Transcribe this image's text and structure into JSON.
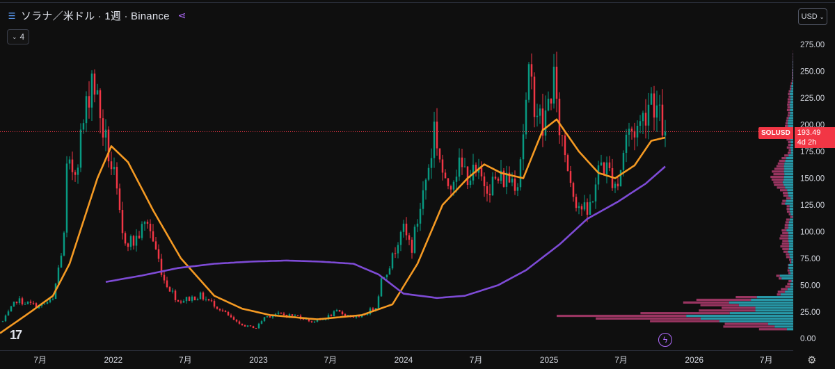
{
  "header": {
    "title": "ソラナ／米ドル · 1週 · Binance",
    "indicator_count": "4"
  },
  "currency_button": "USD",
  "price_badge": {
    "symbol": "SOLUSD",
    "price": "193.49",
    "countdown": "4d 2h"
  },
  "chart_data": {
    "type": "candlestick",
    "last_price": 193.49,
    "y_range": [
      -7,
      292
    ],
    "y_ticks": [
      0,
      25,
      50,
      75,
      100,
      125,
      150,
      175,
      200,
      225,
      250,
      275
    ],
    "y_tick_labels": [
      "0.00",
      "25.00",
      "50.00",
      "75.00",
      "100.00",
      "125.00",
      "150.00",
      "175.00",
      "200.00",
      "225.00",
      "250.00",
      "275.00"
    ],
    "x_range": [
      "2021-03-22",
      "2026-09-07"
    ],
    "x_ticks": [
      {
        "date": "2021-07-01",
        "label": "7月"
      },
      {
        "date": "2022-01-01",
        "label": "2022"
      },
      {
        "date": "2022-07-01",
        "label": "7月"
      },
      {
        "date": "2023-01-01",
        "label": "2023"
      },
      {
        "date": "2023-07-01",
        "label": "7月"
      },
      {
        "date": "2024-01-01",
        "label": "2024"
      },
      {
        "date": "2024-07-01",
        "label": "7月"
      },
      {
        "date": "2025-01-01",
        "label": "2025"
      },
      {
        "date": "2025-07-01",
        "label": "7月"
      },
      {
        "date": "2026-01-01",
        "label": "2026"
      },
      {
        "date": "2026-07-01",
        "label": "7月"
      }
    ],
    "price_path_date_anchors": [
      "2021-03-29",
      "2021-05-03",
      "2021-06-28",
      "2021-08-02",
      "2021-08-30",
      "2021-09-06",
      "2021-09-27",
      "2021-10-25",
      "2021-11-08",
      "2021-12-06",
      "2022-01-03",
      "2022-01-24",
      "2022-02-21",
      "2022-03-28",
      "2022-05-09",
      "2022-06-13",
      "2022-08-08",
      "2022-09-12",
      "2022-11-07",
      "2022-11-14",
      "2022-12-26",
      "2023-01-16",
      "2023-02-13",
      "2023-04-10",
      "2023-05-15",
      "2023-06-12",
      "2023-07-17",
      "2023-08-21",
      "2023-09-11",
      "2023-10-23",
      "2023-11-06",
      "2023-12-04",
      "2023-12-25",
      "2024-01-22",
      "2024-03-11",
      "2024-03-18",
      "2024-04-15",
      "2024-05-13",
      "2024-07-08",
      "2024-08-05",
      "2024-09-09",
      "2024-10-14",
      "2024-11-11",
      "2024-11-18",
      "2024-12-16",
      "2025-01-13",
      "2025-01-20",
      "2025-02-24",
      "2025-03-10",
      "2025-04-07",
      "2025-05-12",
      "2025-06-23",
      "2025-07-14",
      "2025-08-18",
      "2025-09-15",
      "2025-10-06",
      "2025-10-20"
    ],
    "price_path_value_anchors": [
      16,
      36,
      30,
      36,
      95,
      155,
      160,
      215,
      250,
      195,
      150,
      95,
      90,
      110,
      55,
      35,
      40,
      32,
      15,
      13,
      10,
      20,
      23,
      21,
      16,
      18,
      25,
      21,
      19,
      30,
      55,
      75,
      105,
      85,
      175,
      200,
      140,
      160,
      150,
      145,
      150,
      150,
      240,
      235,
      195,
      245,
      210,
      150,
      130,
      115,
      165,
      145,
      190,
      200,
      230,
      205,
      193.49
    ],
    "moving_averages": [
      {
        "color": "#f59a23",
        "date_anchors": [
          "2021-03-22",
          "2021-06-07",
          "2021-08-02",
          "2021-09-13",
          "2021-10-18",
          "2021-11-22",
          "2021-12-27",
          "2022-02-07",
          "2022-04-11",
          "2022-06-20",
          "2022-09-12",
          "2022-11-21",
          "2023-01-30",
          "2023-05-29",
          "2023-09-18",
          "2023-12-04",
          "2024-02-05",
          "2024-04-08",
          "2024-06-10",
          "2024-07-22",
          "2024-09-02",
          "2024-10-28",
          "2024-12-16",
          "2025-01-20",
          "2025-03-17",
          "2025-05-05",
          "2025-06-16",
          "2025-08-04",
          "2025-09-15",
          "2025-10-20"
        ],
        "value_anchors": [
          5,
          25,
          40,
          70,
          110,
          150,
          180,
          165,
          120,
          75,
          40,
          28,
          22,
          18,
          22,
          32,
          70,
          125,
          150,
          163,
          155,
          150,
          195,
          205,
          175,
          155,
          150,
          162,
          185,
          188
        ]
      },
      {
        "color": "#7e4bd6",
        "date_anchors": [
          "2021-12-13",
          "2022-03-14",
          "2022-06-13",
          "2022-09-12",
          "2022-12-12",
          "2023-03-13",
          "2023-06-05",
          "2023-08-28",
          "2023-10-30",
          "2024-01-01",
          "2024-03-25",
          "2024-06-03",
          "2024-08-26",
          "2024-11-04",
          "2025-01-27",
          "2025-04-07",
          "2025-06-23",
          "2025-09-01",
          "2025-10-20"
        ],
        "value_anchors": [
          53,
          59,
          66,
          70,
          72,
          73,
          72,
          70,
          60,
          42,
          38,
          40,
          50,
          64,
          88,
          112,
          128,
          145,
          161
        ]
      }
    ],
    "volume_profile": {
      "price_step": 2.5,
      "range": [
        0,
        290
      ]
    }
  }
}
